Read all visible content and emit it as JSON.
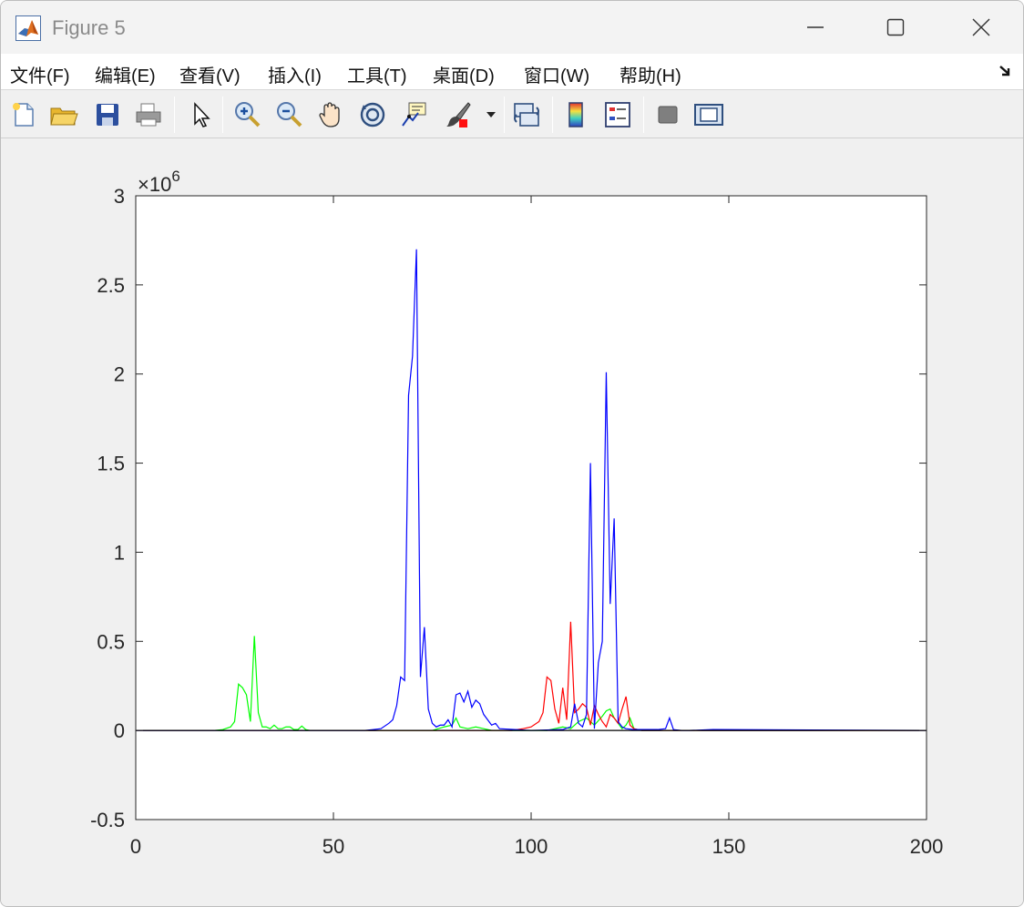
{
  "window": {
    "title": "Figure 5"
  },
  "menu": {
    "items": [
      "文件(F)",
      "编辑(E)",
      "查看(V)",
      "插入(I)",
      "工具(T)",
      "桌面(D)",
      "窗口(W)",
      "帮助(H)"
    ]
  },
  "toolbar": {
    "icons": [
      "new-figure-icon",
      "open-file-icon",
      "save-icon",
      "print-icon",
      "select-pointer-icon",
      "zoom-in-icon",
      "zoom-out-icon",
      "pan-hand-icon",
      "rotate-3d-icon",
      "data-cursor-icon",
      "brush-icon",
      "brush-dropdown-icon",
      "link-plot-icon",
      "colorbar-icon",
      "legend-icon",
      "hide-plot-tools-icon",
      "show-plot-tools-icon"
    ]
  },
  "colors": {
    "blue": "#0000ff",
    "red": "#ff0000",
    "green": "#00ff00",
    "axis": "#262626"
  },
  "chart_data": {
    "type": "line",
    "title": "",
    "xlabel": "",
    "ylabel": "",
    "xlim": [
      0,
      200
    ],
    "ylim": [
      -0.5,
      3
    ],
    "y_exponent": "×10^6",
    "y_exponent_base": "×10",
    "y_exponent_power": "6",
    "xticks": [
      0,
      50,
      100,
      150,
      200
    ],
    "xtick_labels": [
      "0",
      "50",
      "100",
      "150",
      "200"
    ],
    "yticks": [
      -0.5,
      0,
      0.5,
      1,
      1.5,
      2,
      2.5,
      3
    ],
    "ytick_labels": [
      "-0.5",
      "0",
      "0.5",
      "1",
      "1.5",
      "2",
      "2.5",
      "3"
    ],
    "grid": false,
    "series": [
      {
        "color": "#00ff00",
        "x": [
          0,
          20,
          22,
          24,
          25,
          26,
          27,
          28,
          29,
          30,
          31,
          32,
          33,
          34,
          35,
          36,
          37,
          38,
          39,
          40,
          41,
          42,
          43,
          44,
          50,
          75,
          78,
          80,
          81,
          82,
          84,
          86,
          88,
          90,
          100,
          104,
          106,
          108,
          110,
          112,
          114,
          116,
          118,
          119,
          120,
          121,
          122,
          123,
          124,
          125,
          126,
          128,
          200
        ],
        "y": [
          0,
          0,
          0.005,
          0.02,
          0.05,
          0.26,
          0.24,
          0.2,
          0.05,
          0.53,
          0.1,
          0.02,
          0.02,
          0.01,
          0.03,
          0.01,
          0.01,
          0.02,
          0.02,
          0.005,
          0.005,
          0.025,
          0.005,
          0,
          0,
          0,
          0.02,
          0.03,
          0.07,
          0.02,
          0.01,
          0.02,
          0.01,
          0,
          0,
          0,
          0.01,
          0.02,
          0.01,
          0.05,
          0.07,
          0.03,
          0.08,
          0.11,
          0.12,
          0.07,
          0.04,
          0.01,
          0.03,
          0.07,
          0.01,
          0,
          0
        ]
      },
      {
        "color": "#ff0000",
        "x": [
          0,
          95,
          98,
          100,
          102,
          103,
          104,
          105,
          106,
          107,
          108,
          109,
          110,
          111,
          112,
          113,
          114,
          115,
          116,
          117,
          118,
          119,
          120,
          121,
          122,
          123,
          124,
          125,
          126,
          127,
          128,
          200
        ],
        "y": [
          0,
          0,
          0.01,
          0.02,
          0.05,
          0.1,
          0.3,
          0.28,
          0.12,
          0.04,
          0.24,
          0.06,
          0.61,
          0.1,
          0.12,
          0.15,
          0.13,
          0.03,
          0.14,
          0.09,
          0.05,
          0.02,
          0.09,
          0.07,
          0.04,
          0.12,
          0.19,
          0.03,
          0.01,
          0.005,
          0,
          0
        ]
      },
      {
        "color": "#0000ff",
        "x": [
          0,
          58,
          60,
          62,
          64,
          65,
          66,
          67,
          68,
          69,
          70,
          71,
          72,
          73,
          74,
          75,
          76,
          77,
          78,
          79,
          80,
          81,
          82,
          83,
          84,
          85,
          86,
          87,
          88,
          89,
          90,
          91,
          92,
          100,
          108,
          110,
          111,
          112,
          113,
          114,
          115,
          116,
          117,
          118,
          119,
          120,
          121,
          122,
          123,
          124,
          126,
          128,
          130,
          132,
          134,
          135,
          136,
          138,
          140,
          146,
          200
        ],
        "y": [
          0,
          0,
          0.005,
          0.01,
          0.04,
          0.06,
          0.14,
          0.3,
          0.28,
          1.88,
          2.1,
          2.7,
          0.3,
          0.58,
          0.12,
          0.04,
          0.02,
          0.03,
          0.03,
          0.06,
          0.02,
          0.2,
          0.21,
          0.16,
          0.22,
          0.13,
          0.17,
          0.15,
          0.09,
          0.06,
          0.03,
          0.04,
          0.01,
          0,
          0.005,
          0.02,
          0.15,
          0.04,
          0.02,
          0.09,
          1.5,
          0.01,
          0.38,
          0.5,
          2.01,
          0.71,
          1.19,
          0.05,
          0.02,
          0.01,
          0.005,
          0.005,
          0.005,
          0.005,
          0.01,
          0.07,
          0.005,
          0,
          0,
          0.005,
          0
        ]
      },
      {
        "color": "#000000",
        "x": [
          0,
          200
        ],
        "y": [
          0,
          0
        ]
      }
    ]
  }
}
